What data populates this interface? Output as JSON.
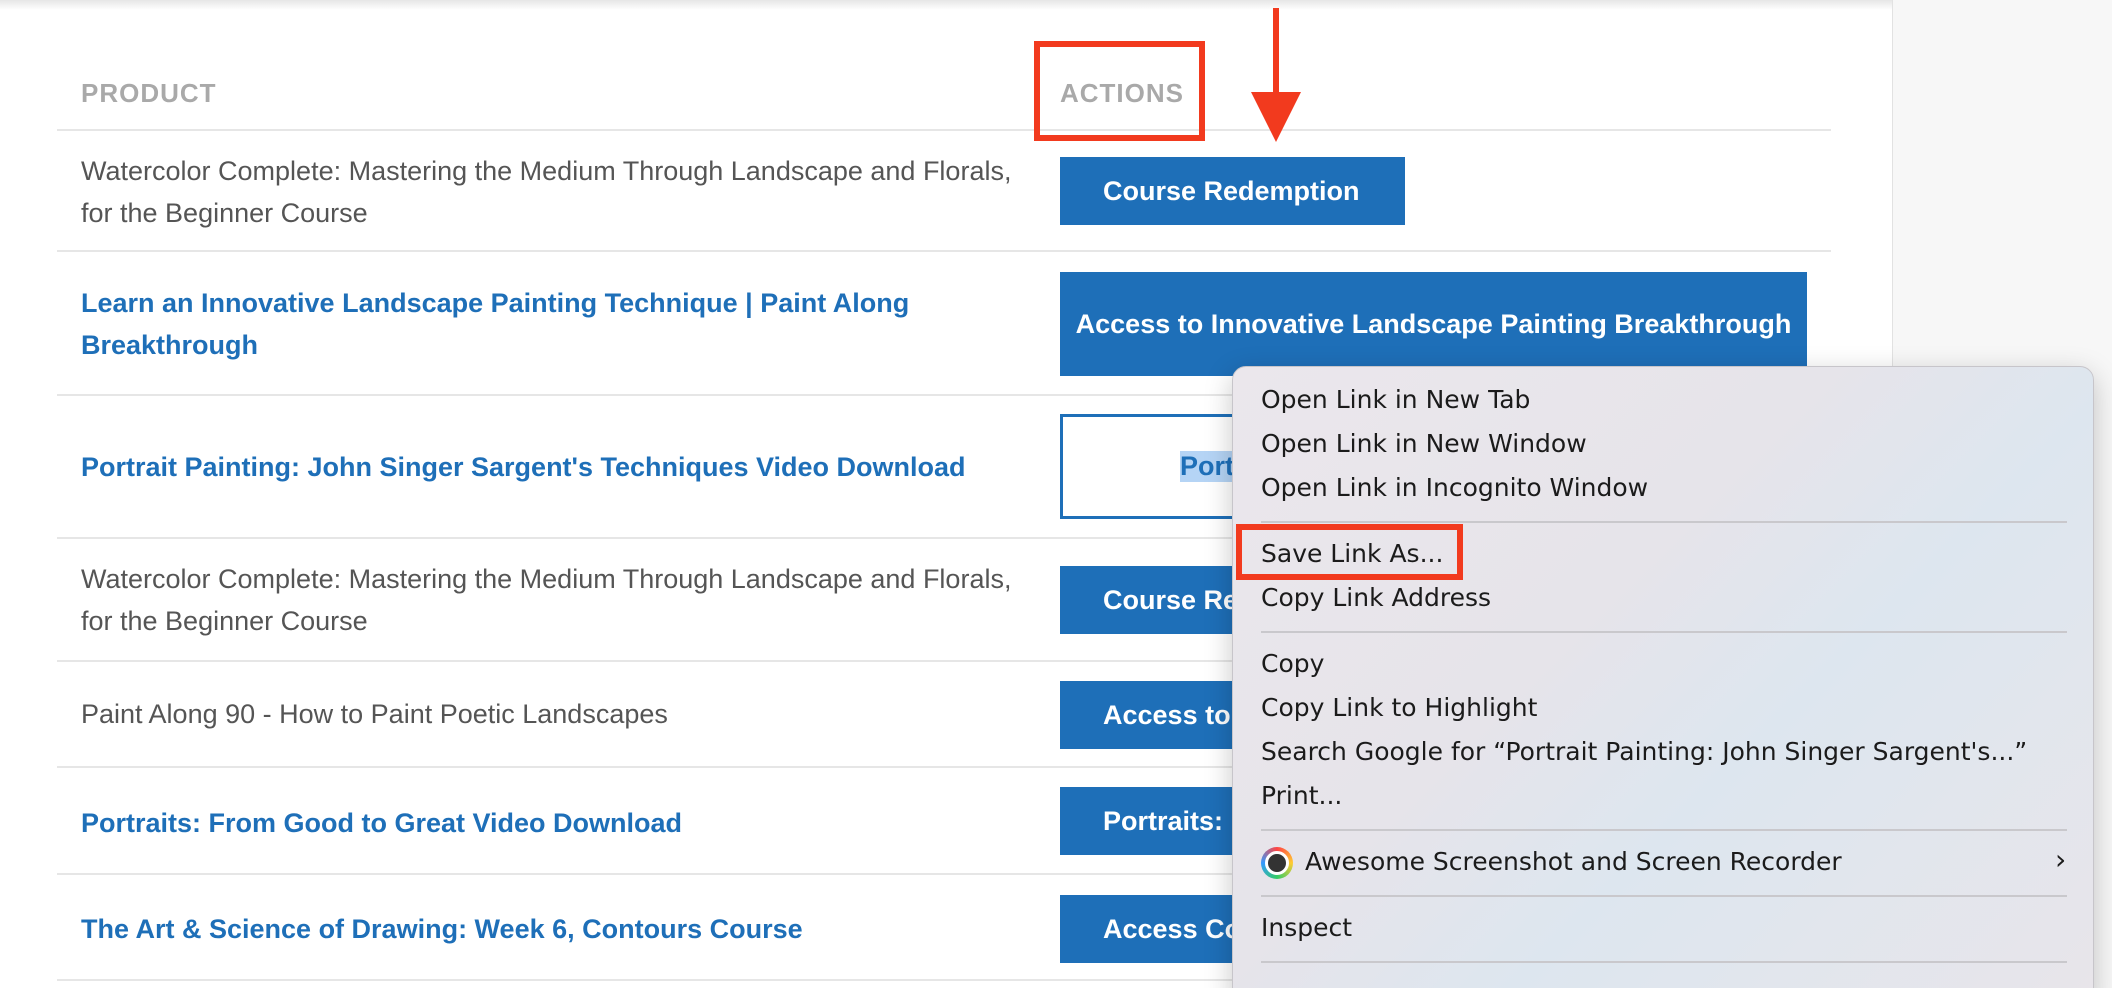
{
  "table": {
    "headers": {
      "product": "PRODUCT",
      "actions": "ACTIONS"
    },
    "rows": [
      {
        "product": "Watercolor Complete: Mastering the Medium Through Landscape and Florals, for the Beginner Course",
        "product_is_link": false,
        "action": "Course Redemption"
      },
      {
        "product": "Learn an Innovative Landscape Painting Technique | Paint Along Breakthrough",
        "product_is_link": true,
        "action": "Access to Innovative Landscape Painting Breakthrough"
      },
      {
        "product": "Portrait Painting: John Singer Sargent's Techniques Video Download",
        "product_is_link": true,
        "action": "Port"
      },
      {
        "product": "Watercolor Complete: Mastering the Medium Through Landscape and Florals, for the Beginner Course",
        "product_is_link": false,
        "action": "Course Re"
      },
      {
        "product": "Paint Along 90 - How to Paint Poetic Landscapes",
        "product_is_link": false,
        "action": "Access to"
      },
      {
        "product": "Portraits: From Good to Great Video Download",
        "product_is_link": true,
        "action": "Portraits:"
      },
      {
        "product": "The Art & Science of Drawing: Week 6, Contours Course",
        "product_is_link": true,
        "action": "Access Co"
      }
    ]
  },
  "context_menu": {
    "items": [
      "Open Link in New Tab",
      "Open Link in New Window",
      "Open Link in Incognito Window",
      "Save Link As...",
      "Copy Link Address",
      "Copy",
      "Copy Link to Highlight",
      "Search Google for “Portrait Painting: John Singer Sargent's...”",
      "Print...",
      "Awesome Screenshot and Screen Recorder",
      "Inspect"
    ],
    "submenu_icon": "chevron-right-icon",
    "extension_icon": "awesome-screenshot-icon"
  },
  "annotation_color": "#f23a1e",
  "brand_color": "#1e6fb8"
}
